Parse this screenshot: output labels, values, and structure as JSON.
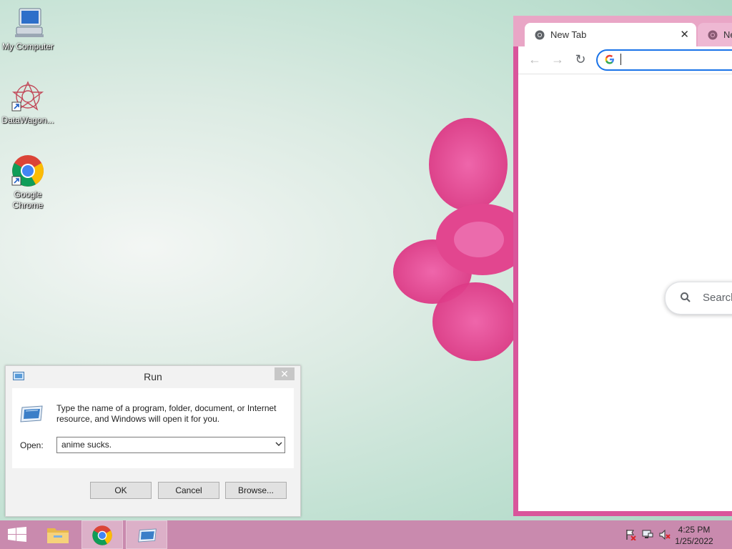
{
  "desktop": {
    "icons": [
      {
        "label": "My Computer",
        "icon": "computer-icon"
      },
      {
        "label": "DataWagon...",
        "icon": "datawagon-icon"
      },
      {
        "label": "Google Chrome",
        "icon": "chrome-icon"
      }
    ]
  },
  "chrome": {
    "tabs": [
      {
        "title": "New Tab",
        "active": true
      },
      {
        "title": "Ne",
        "active": false
      }
    ],
    "close_tab": "✕",
    "back": "←",
    "forward": "→",
    "reload": "↻",
    "search_placeholder": "Search"
  },
  "run_dialog": {
    "title": "Run",
    "close": "✕",
    "description": "Type the name of a program, folder, document, or Internet resource, and Windows will open it for you.",
    "open_label": "Open:",
    "open_value": "anime sucks.",
    "buttons": {
      "ok": "OK",
      "cancel": "Cancel",
      "browse": "Browse..."
    }
  },
  "taskbar": {
    "items": [
      "start-icon",
      "file-explorer-icon",
      "chrome-icon",
      "run-icon"
    ],
    "tray": [
      "action-center-flag-icon",
      "network-icon",
      "volume-muted-icon"
    ],
    "time": "4:25 PM",
    "date": "1/25/2022"
  },
  "colors": {
    "window_border": "#d9559b",
    "taskbar": "#c98aae",
    "accent": "#1a73e8"
  }
}
